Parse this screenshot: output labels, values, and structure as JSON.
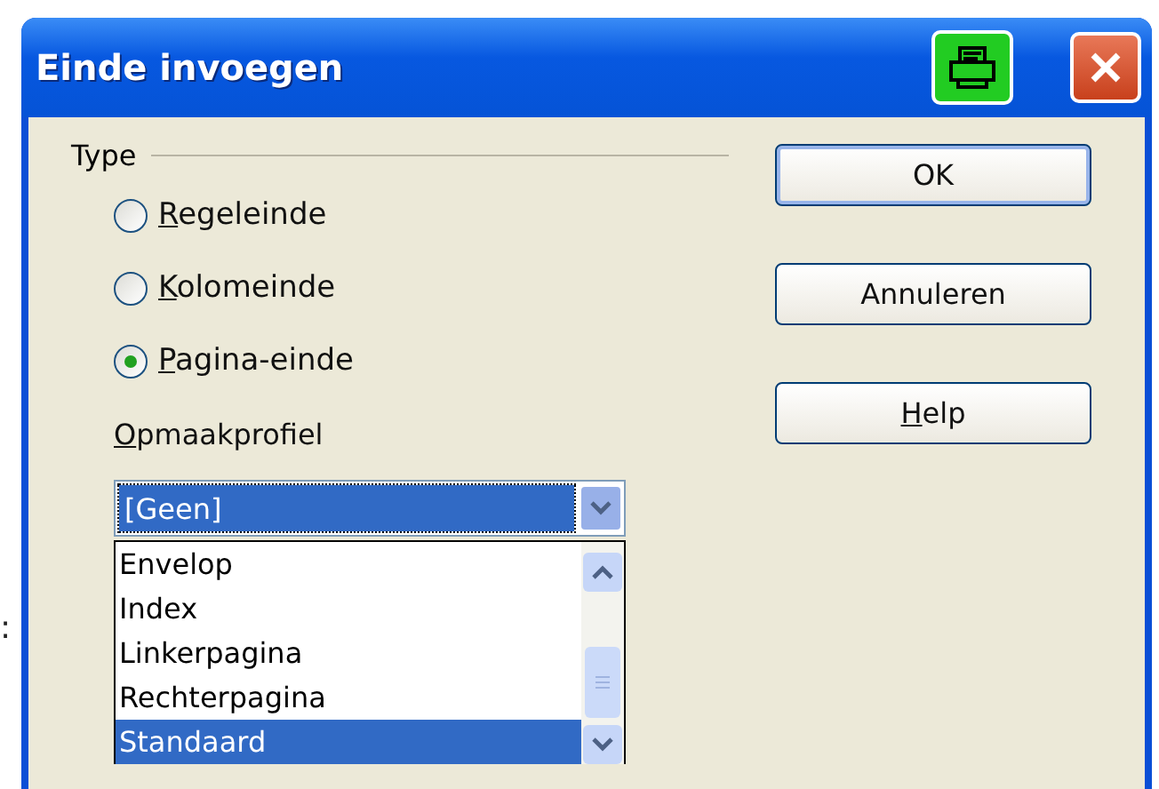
{
  "background_text": ":",
  "window": {
    "title": "Einde invoegen"
  },
  "type_group": {
    "label": "Type",
    "options": [
      {
        "label": "Regeleinde",
        "selected": false,
        "underline_first": true
      },
      {
        "label": "Kolomeinde",
        "selected": false,
        "underline_first": true
      },
      {
        "label": "Pagina-einde",
        "selected": true,
        "underline_first": true
      }
    ]
  },
  "style_label": {
    "label": "Opmaakprofiel",
    "underline_first": true
  },
  "style_combo": {
    "value": "[Geen]",
    "expanded": true,
    "items": [
      {
        "label": "Envelop",
        "selected": false
      },
      {
        "label": "Index",
        "selected": false
      },
      {
        "label": "Linkerpagina",
        "selected": false
      },
      {
        "label": "Rechterpagina",
        "selected": false
      },
      {
        "label": "Standaard",
        "selected": true
      }
    ]
  },
  "buttons": [
    {
      "label": "OK",
      "default": true,
      "underline_first": false
    },
    {
      "label": "Annuleren",
      "default": false,
      "underline_first": false
    },
    {
      "label": "Help",
      "default": false,
      "underline_first": true
    }
  ]
}
